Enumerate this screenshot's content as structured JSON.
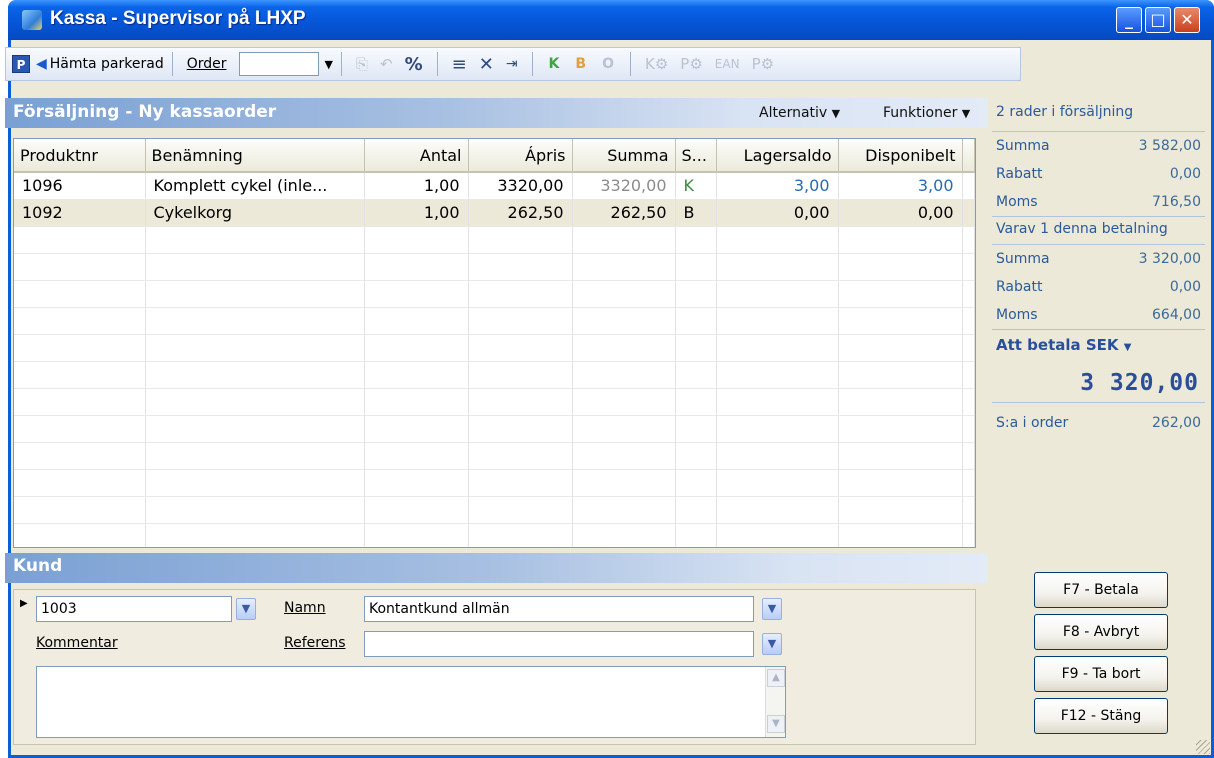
{
  "window": {
    "title": "Kassa - Supervisor på LHXP"
  },
  "toolbar": {
    "parked_label": "Hämta parkerad",
    "order_label": "Order",
    "letters": [
      "K",
      "B",
      "O"
    ],
    "ean_label": "EAN"
  },
  "sales": {
    "title": "Försäljning - Ny kassaorder",
    "menu_alternativ": "Alternativ",
    "menu_funktioner": "Funktioner",
    "columns": [
      "Produktnr",
      "Benämning",
      "Antal",
      "Ápris",
      "Summa",
      "S...",
      "Lagersaldo",
      "Disponibelt"
    ],
    "rows": [
      [
        "1096",
        "Komplett cykel (inle...",
        "1,00",
        "3320,00",
        "3320,00",
        "K",
        "3,00",
        "3,00"
      ],
      [
        "1092",
        "Cykelkorg",
        "1,00",
        "262,50",
        "262,50",
        "B",
        "0,00",
        "0,00"
      ]
    ]
  },
  "summary": {
    "header": "2 rader i försäljning",
    "totals": [
      {
        "label": "Summa",
        "value": "3 582,00"
      },
      {
        "label": "Rabatt",
        "value": "0,00"
      },
      {
        "label": "Moms",
        "value": "716,50"
      }
    ],
    "payment_header": "Varav 1 denna betalning",
    "payment": [
      {
        "label": "Summa",
        "value": "3 320,00"
      },
      {
        "label": "Rabatt",
        "value": "0,00"
      },
      {
        "label": "Moms",
        "value": "664,00"
      }
    ],
    "to_pay_label": "Att betala",
    "currency": "SEK",
    "to_pay_amount": "3 320,00",
    "order_sum_label": "S:a i order",
    "order_sum_value": "262,00"
  },
  "customer": {
    "title": "Kund",
    "number": "1003",
    "name_label": "Namn",
    "name_value": "Kontantkund allmän",
    "comment_label": "Kommentar",
    "reference_label": "Referens",
    "reference_value": ""
  },
  "functions": [
    "F7 - Betala",
    "F8 - Avbryt",
    "F9 - Ta bort",
    "F12 - Stäng"
  ]
}
